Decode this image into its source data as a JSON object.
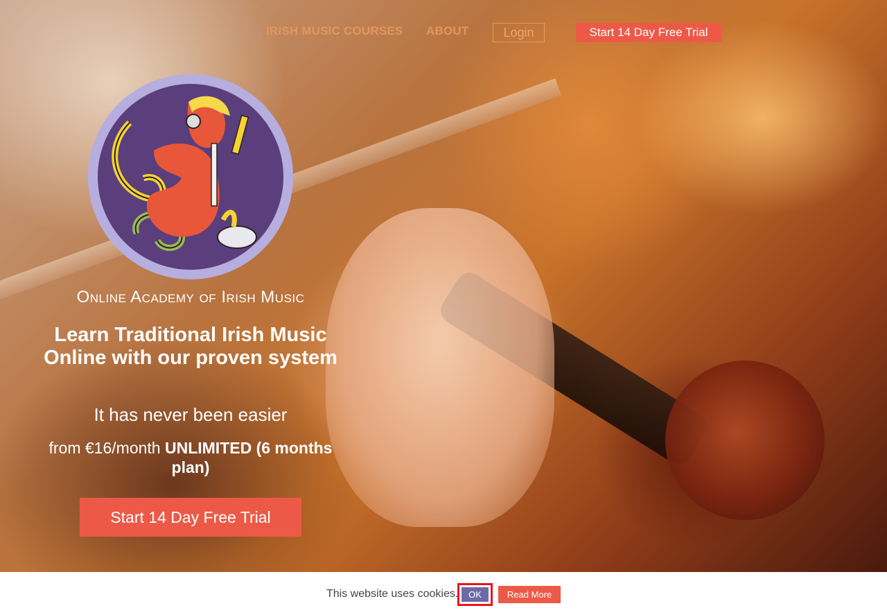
{
  "nav": {
    "courses": "IRISH MUSIC COURSES",
    "about": "ABOUT",
    "login": "Login",
    "trial": "Start 14 Day Free Trial"
  },
  "hero": {
    "academy_name": "Online Academy of Irish Music",
    "headline": "Learn Traditional Irish Music Online with our proven system",
    "tagline": "It has never been easier",
    "price_prefix": "from €16/month",
    "price_bold": "UNLIMITED (6 months plan)",
    "cta": "Start 14 Day Free Trial"
  },
  "cookie": {
    "text": "This website uses cookies.",
    "ok": "OK",
    "read_more": "Read More"
  },
  "colors": {
    "accent": "#ec5a47",
    "nav_link": "#e4965a",
    "logo_ring": "#b6aede",
    "logo_fill": "#5b3e7c",
    "ok_button": "#6e6aa8"
  }
}
